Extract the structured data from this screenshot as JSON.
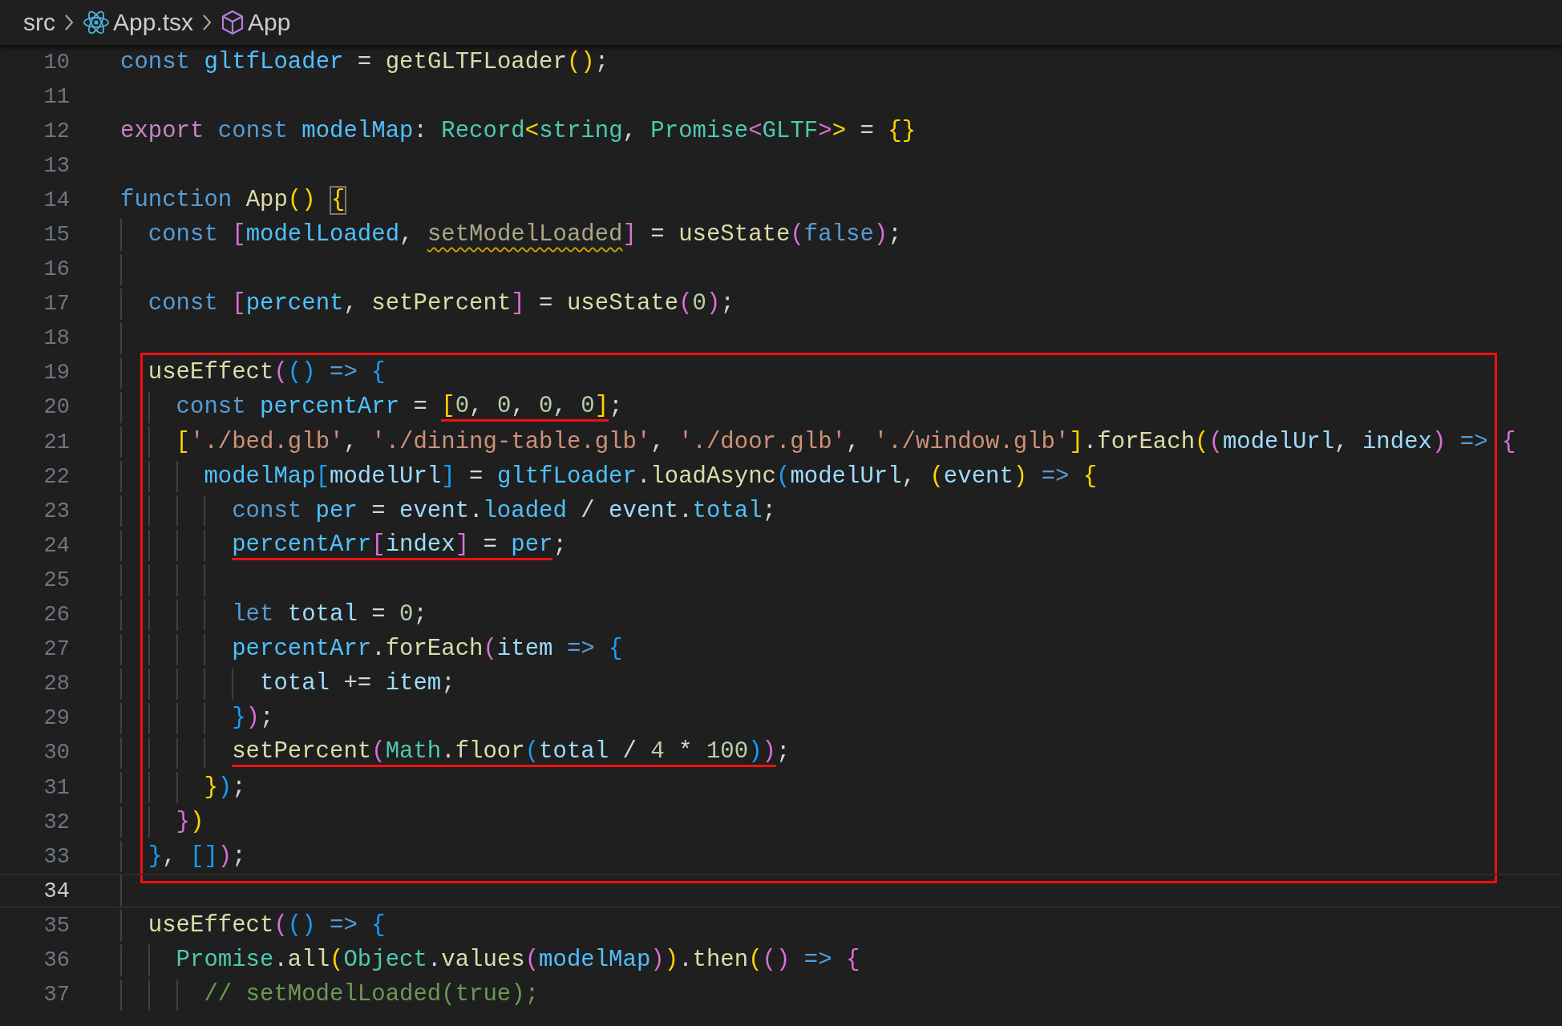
{
  "breadcrumb": [
    {
      "kind": "folder",
      "label": "src"
    },
    {
      "kind": "react-file",
      "label": "App.tsx"
    },
    {
      "kind": "component",
      "label": "App"
    }
  ],
  "lines": [
    {
      "number": "10",
      "current": false,
      "boxed": false,
      "segments": [
        {
          "kind": "keyword",
          "text": "const"
        },
        {
          "kind": "constant",
          "text": " gltfLoader"
        },
        {
          "kind": "punct",
          "text": " = "
        },
        {
          "kind": "function",
          "text": "getGLTFLoader"
        },
        {
          "kind": "bracket1",
          "text": "()"
        },
        {
          "kind": "punct",
          "text": ";"
        }
      ]
    },
    {
      "number": "11",
      "current": false,
      "boxed": false
    },
    {
      "number": "12",
      "current": false,
      "boxed": false,
      "segments": [
        {
          "kind": "control",
          "text": "export"
        },
        {
          "kind": "keyword",
          "text": " const"
        },
        {
          "kind": "constant",
          "text": " modelMap"
        },
        {
          "kind": "punct",
          "text": ": "
        },
        {
          "kind": "type",
          "text": "Record"
        },
        {
          "kind": "bracket1",
          "text": "<"
        },
        {
          "kind": "type",
          "text": "string"
        },
        {
          "kind": "punct",
          "text": ", "
        },
        {
          "kind": "type",
          "text": "Promise"
        },
        {
          "kind": "bracket2",
          "text": "<"
        },
        {
          "kind": "type",
          "text": "GLTF"
        },
        {
          "kind": "bracket2",
          "text": ">"
        },
        {
          "kind": "bracket1",
          "text": ">"
        },
        {
          "kind": "punct",
          "text": " = "
        },
        {
          "kind": "bracket1",
          "text": "{}"
        }
      ]
    },
    {
      "number": "13",
      "current": false,
      "boxed": false
    },
    {
      "number": "14",
      "current": false,
      "boxed": false,
      "segments": [
        {
          "kind": "keyword",
          "text": "function"
        },
        {
          "kind": "function",
          "text": " App"
        },
        {
          "kind": "bracket1",
          "text": "() "
        },
        {
          "kind": "bracket-match",
          "text": "{"
        }
      ]
    },
    {
      "number": "15",
      "current": false,
      "boxed": false,
      "segments": [
        {
          "kind": "keyword",
          "text": "  const"
        },
        {
          "kind": "bracket2",
          "text": " ["
        },
        {
          "kind": "constant",
          "text": "modelLoaded"
        },
        {
          "kind": "punct",
          "text": ", "
        },
        {
          "kind": "unused",
          "text": "setModelLoaded"
        },
        {
          "kind": "bracket2",
          "text": "]"
        },
        {
          "kind": "punct",
          "text": " = "
        },
        {
          "kind": "function",
          "text": "useState"
        },
        {
          "kind": "bracket2",
          "text": "("
        },
        {
          "kind": "keyword",
          "text": "false"
        },
        {
          "kind": "bracket2",
          "text": ")"
        },
        {
          "kind": "punct",
          "text": ";"
        }
      ]
    },
    {
      "number": "16",
      "current": false,
      "boxed": false
    },
    {
      "number": "17",
      "current": false,
      "boxed": false,
      "segments": [
        {
          "kind": "keyword",
          "text": "  const"
        },
        {
          "kind": "bracket2",
          "text": " ["
        },
        {
          "kind": "constant",
          "text": "percent"
        },
        {
          "kind": "punct",
          "text": ", "
        },
        {
          "kind": "function",
          "text": "setPercent"
        },
        {
          "kind": "bracket2",
          "text": "]"
        },
        {
          "kind": "punct",
          "text": " = "
        },
        {
          "kind": "function",
          "text": "useState"
        },
        {
          "kind": "bracket2",
          "text": "("
        },
        {
          "kind": "number",
          "text": "0"
        },
        {
          "kind": "bracket2",
          "text": ")"
        },
        {
          "kind": "punct",
          "text": ";"
        }
      ]
    },
    {
      "number": "18",
      "current": false,
      "boxed": false
    },
    {
      "number": "19",
      "current": false,
      "boxed": true,
      "segments": [
        {
          "kind": "function",
          "text": "  useEffect"
        },
        {
          "kind": "bracket2",
          "text": "("
        },
        {
          "kind": "bracket3",
          "text": "()"
        },
        {
          "kind": "keyword",
          "text": " =>"
        },
        {
          "kind": "bracket3",
          "text": " {"
        }
      ]
    },
    {
      "number": "20",
      "current": false,
      "boxed": true,
      "segments": [
        {
          "kind": "keyword",
          "text": "    const"
        },
        {
          "kind": "constant",
          "text": " percentArr"
        },
        {
          "kind": "punct",
          "text": " = "
        },
        {
          "kind": "underline",
          "segments": [
            {
              "kind": "bracket1",
              "text": "["
            },
            {
              "kind": "number",
              "text": "0"
            },
            {
              "kind": "punct",
              "text": ", "
            },
            {
              "kind": "number",
              "text": "0"
            },
            {
              "kind": "punct",
              "text": ", "
            },
            {
              "kind": "number",
              "text": "0"
            },
            {
              "kind": "punct",
              "text": ", "
            },
            {
              "kind": "number",
              "text": "0"
            },
            {
              "kind": "bracket1",
              "text": "]"
            }
          ]
        },
        {
          "kind": "punct",
          "text": ";"
        }
      ]
    },
    {
      "number": "21",
      "current": false,
      "boxed": true,
      "segments": [
        {
          "kind": "bracket1",
          "text": "    ["
        },
        {
          "kind": "string",
          "text": "'./bed.glb'"
        },
        {
          "kind": "punct",
          "text": ", "
        },
        {
          "kind": "string",
          "text": "'./dining-table.glb'"
        },
        {
          "kind": "punct",
          "text": ", "
        },
        {
          "kind": "string",
          "text": "'./door.glb'"
        },
        {
          "kind": "punct",
          "text": ", "
        },
        {
          "kind": "string",
          "text": "'./window.glb'"
        },
        {
          "kind": "bracket1",
          "text": "]"
        },
        {
          "kind": "punct",
          "text": "."
        },
        {
          "kind": "function",
          "text": "forEach"
        },
        {
          "kind": "bracket1",
          "text": "("
        },
        {
          "kind": "bracket2",
          "text": "("
        },
        {
          "kind": "variable",
          "text": "modelUrl"
        },
        {
          "kind": "punct",
          "text": ", "
        },
        {
          "kind": "variable",
          "text": "index"
        },
        {
          "kind": "bracket2",
          "text": ")"
        },
        {
          "kind": "keyword",
          "text": " =>"
        },
        {
          "kind": "bracket2",
          "text": " {"
        }
      ]
    },
    {
      "number": "22",
      "current": false,
      "boxed": true,
      "segments": [
        {
          "kind": "constant",
          "text": "      modelMap"
        },
        {
          "kind": "bracket3",
          "text": "["
        },
        {
          "kind": "variable",
          "text": "modelUrl"
        },
        {
          "kind": "bracket3",
          "text": "]"
        },
        {
          "kind": "punct",
          "text": " = "
        },
        {
          "kind": "constant",
          "text": "gltfLoader"
        },
        {
          "kind": "punct",
          "text": "."
        },
        {
          "kind": "function",
          "text": "loadAsync"
        },
        {
          "kind": "bracket3",
          "text": "("
        },
        {
          "kind": "variable",
          "text": "modelUrl"
        },
        {
          "kind": "punct",
          "text": ", "
        },
        {
          "kind": "bracket1",
          "text": "("
        },
        {
          "kind": "variable",
          "text": "event"
        },
        {
          "kind": "bracket1",
          "text": ")"
        },
        {
          "kind": "keyword",
          "text": " =>"
        },
        {
          "kind": "bracket1",
          "text": " {"
        }
      ]
    },
    {
      "number": "23",
      "current": false,
      "boxed": true,
      "segments": [
        {
          "kind": "keyword",
          "text": "        const"
        },
        {
          "kind": "constant",
          "text": " per"
        },
        {
          "kind": "punct",
          "text": " = "
        },
        {
          "kind": "variable",
          "text": "event"
        },
        {
          "kind": "punct",
          "text": "."
        },
        {
          "kind": "constant",
          "text": "loaded"
        },
        {
          "kind": "punct",
          "text": " / "
        },
        {
          "kind": "variable",
          "text": "event"
        },
        {
          "kind": "punct",
          "text": "."
        },
        {
          "kind": "constant",
          "text": "total"
        },
        {
          "kind": "punct",
          "text": ";"
        }
      ]
    },
    {
      "number": "24",
      "current": false,
      "boxed": true,
      "segments": [
        {
          "kind": "underline",
          "segments": [
            {
              "kind": "constant",
              "text": "        percentArr"
            },
            {
              "kind": "bracket2",
              "text": "["
            },
            {
              "kind": "variable",
              "text": "index"
            },
            {
              "kind": "bracket2",
              "text": "]"
            },
            {
              "kind": "punct",
              "text": " = "
            },
            {
              "kind": "constant",
              "text": "per"
            }
          ]
        },
        {
          "kind": "punct",
          "text": ";"
        }
      ]
    },
    {
      "number": "25",
      "current": false,
      "boxed": true
    },
    {
      "number": "26",
      "current": false,
      "boxed": true,
      "segments": [
        {
          "kind": "keyword",
          "text": "        let"
        },
        {
          "kind": "variable",
          "text": " total"
        },
        {
          "kind": "punct",
          "text": " = "
        },
        {
          "kind": "number",
          "text": "0"
        },
        {
          "kind": "punct",
          "text": ";"
        }
      ]
    },
    {
      "number": "27",
      "current": false,
      "boxed": true,
      "segments": [
        {
          "kind": "constant",
          "text": "        percentArr"
        },
        {
          "kind": "punct",
          "text": "."
        },
        {
          "kind": "function",
          "text": "forEach"
        },
        {
          "kind": "bracket2",
          "text": "("
        },
        {
          "kind": "variable",
          "text": "item"
        },
        {
          "kind": "keyword",
          "text": " =>"
        },
        {
          "kind": "bracket3",
          "text": " {"
        }
      ]
    },
    {
      "number": "28",
      "current": false,
      "boxed": true,
      "segments": [
        {
          "kind": "variable",
          "text": "          total"
        },
        {
          "kind": "punct",
          "text": " += "
        },
        {
          "kind": "variable",
          "text": "item"
        },
        {
          "kind": "punct",
          "text": ";"
        }
      ]
    },
    {
      "number": "29",
      "current": false,
      "boxed": true,
      "segments": [
        {
          "kind": "bracket3",
          "text": "        }"
        },
        {
          "kind": "bracket2",
          "text": ")"
        },
        {
          "kind": "punct",
          "text": ";"
        }
      ]
    },
    {
      "number": "30",
      "current": false,
      "boxed": true,
      "segments": [
        {
          "kind": "underline",
          "segments": [
            {
              "kind": "function",
              "text": "        setPercent"
            },
            {
              "kind": "bracket2",
              "text": "("
            },
            {
              "kind": "type",
              "text": "Math"
            },
            {
              "kind": "punct",
              "text": "."
            },
            {
              "kind": "function",
              "text": "floor"
            },
            {
              "kind": "bracket3",
              "text": "("
            },
            {
              "kind": "variable",
              "text": "total"
            },
            {
              "kind": "punct",
              "text": " / "
            },
            {
              "kind": "number",
              "text": "4"
            },
            {
              "kind": "punct",
              "text": " * "
            },
            {
              "kind": "number",
              "text": "100"
            },
            {
              "kind": "bracket3",
              "text": ")"
            },
            {
              "kind": "bracket2",
              "text": ")"
            }
          ]
        },
        {
          "kind": "punct",
          "text": ";"
        }
      ]
    },
    {
      "number": "31",
      "current": false,
      "boxed": true,
      "segments": [
        {
          "kind": "bracket1",
          "text": "      }"
        },
        {
          "kind": "bracket3",
          "text": ")"
        },
        {
          "kind": "punct",
          "text": ";"
        }
      ]
    },
    {
      "number": "32",
      "current": false,
      "boxed": true,
      "segments": [
        {
          "kind": "bracket2",
          "text": "    }"
        },
        {
          "kind": "bracket1",
          "text": ")"
        }
      ]
    },
    {
      "number": "33",
      "current": false,
      "boxed": true,
      "segments": [
        {
          "kind": "bracket3",
          "text": "  }"
        },
        {
          "kind": "punct",
          "text": ", "
        },
        {
          "kind": "bracket3",
          "text": "[]"
        },
        {
          "kind": "bracket2",
          "text": ")"
        },
        {
          "kind": "punct",
          "text": ";"
        }
      ]
    },
    {
      "number": "34",
      "current": true,
      "boxed": false
    },
    {
      "number": "35",
      "current": false,
      "boxed": false,
      "segments": [
        {
          "kind": "function",
          "text": "  useEffect"
        },
        {
          "kind": "bracket2",
          "text": "("
        },
        {
          "kind": "bracket3",
          "text": "()"
        },
        {
          "kind": "keyword",
          "text": " =>"
        },
        {
          "kind": "bracket3",
          "text": " {"
        }
      ]
    },
    {
      "number": "36",
      "current": false,
      "boxed": false,
      "segments": [
        {
          "kind": "type",
          "text": "    Promise"
        },
        {
          "kind": "punct",
          "text": "."
        },
        {
          "kind": "function",
          "text": "all"
        },
        {
          "kind": "bracket1",
          "text": "("
        },
        {
          "kind": "type",
          "text": "Object"
        },
        {
          "kind": "punct",
          "text": "."
        },
        {
          "kind": "function",
          "text": "values"
        },
        {
          "kind": "bracket2",
          "text": "("
        },
        {
          "kind": "constant",
          "text": "modelMap"
        },
        {
          "kind": "bracket2",
          "text": ")"
        },
        {
          "kind": "bracket1",
          "text": ")"
        },
        {
          "kind": "punct",
          "text": "."
        },
        {
          "kind": "function",
          "text": "then"
        },
        {
          "kind": "bracket1",
          "text": "("
        },
        {
          "kind": "bracket2",
          "text": "()"
        },
        {
          "kind": "keyword",
          "text": " =>"
        },
        {
          "kind": "bracket2",
          "text": " {"
        }
      ]
    },
    {
      "number": "37",
      "current": false,
      "boxed": false,
      "segments": [
        {
          "kind": "comment",
          "text": "      // setModelLoaded(true);"
        }
      ]
    }
  ]
}
